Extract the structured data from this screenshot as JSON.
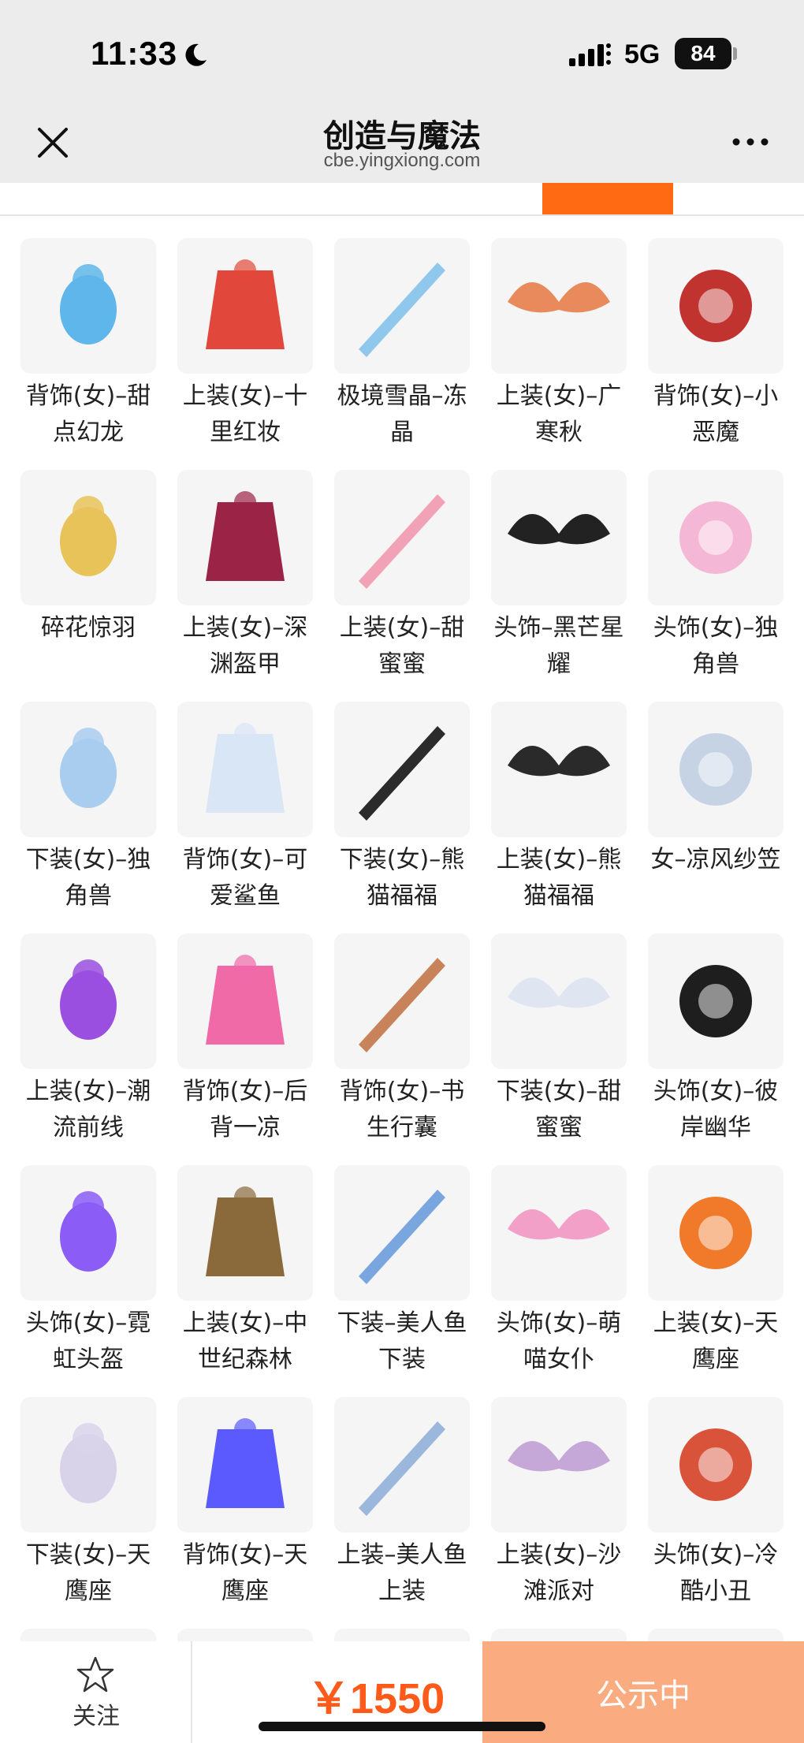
{
  "status_bar": {
    "time": "11:33",
    "network": "5G",
    "battery": "84"
  },
  "nav": {
    "title": "创造与魔法",
    "url": "cbe.yingxiong.com"
  },
  "items": [
    {
      "name": "背饰(女)–甜点幻龙",
      "icon": "dragon-icon",
      "color": "#5fb6ea"
    },
    {
      "name": "上装(女)–十里红妆",
      "icon": "dress-icon",
      "color": "#e2473b"
    },
    {
      "name": "极境雪晶–冻晶",
      "icon": "sword-icon",
      "color": "#8fc8ec"
    },
    {
      "name": "上装(女)–广寒秋",
      "icon": "robe-icon",
      "color": "#e98a5c"
    },
    {
      "name": "背饰(女)–小恶魔",
      "icon": "wings-icon",
      "color": "#c0332f"
    },
    {
      "name": "碎花惊羽",
      "icon": "feather-icon",
      "color": "#e8c35a"
    },
    {
      "name": "上装(女)–深渊盔甲",
      "icon": "armor-icon",
      "color": "#9b2346"
    },
    {
      "name": "上装(女)–甜蜜蜜",
      "icon": "gown-icon",
      "color": "#f2a2b6"
    },
    {
      "name": "头饰–黑芒星耀",
      "icon": "cap-icon",
      "color": "#222222"
    },
    {
      "name": "头饰(女)–独角兽",
      "icon": "unicorn-hood-icon",
      "color": "#f4b8d6"
    },
    {
      "name": "下装(女)–独角兽",
      "icon": "shorts-icon",
      "color": "#a9cdee"
    },
    {
      "name": "背饰(女)–可爱鲨鱼",
      "icon": "shark-icon",
      "color": "#d8e6f6"
    },
    {
      "name": "下装(女)–熊猫福福",
      "icon": "skirt-icon",
      "color": "#2b2b2b"
    },
    {
      "name": "上装(女)–熊猫福福",
      "icon": "jacket-icon",
      "color": "#2a2a2a"
    },
    {
      "name": "女–凉风纱笠",
      "icon": "veil-hat-icon",
      "color": "#c6d3e4"
    },
    {
      "name": "上装(女)–潮流前线",
      "icon": "hoodie-icon",
      "color": "#9a4fe0"
    },
    {
      "name": "背饰(女)–后背一凉",
      "icon": "icecream-icon",
      "color": "#f06aa8"
    },
    {
      "name": "背饰(女)–书生行囊",
      "icon": "backpack-icon",
      "color": "#c9835a"
    },
    {
      "name": "下装(女)–甜蜜蜜",
      "icon": "boots-icon",
      "color": "#dfe6f2"
    },
    {
      "name": "头饰(女)–彼岸幽华",
      "icon": "black-hair-icon",
      "color": "#1e1e1e"
    },
    {
      "name": "头饰(女)–霓虹头盔",
      "icon": "helmet-icon",
      "color": "#8b5cf6"
    },
    {
      "name": "上装(女)–中世纪森林",
      "icon": "medieval-dress-icon",
      "color": "#8a6a3a"
    },
    {
      "name": "下装–美人鱼下装",
      "icon": "fish-tail-icon",
      "color": "#7aa6e0"
    },
    {
      "name": "头饰(女)–萌喵女仆",
      "icon": "pink-hair-icon",
      "color": "#f3a0c8"
    },
    {
      "name": "上装(女)–天鹰座",
      "icon": "orange-jacket-icon",
      "color": "#f07a2a"
    },
    {
      "name": "下装(女)–天鹰座",
      "icon": "pants-icon",
      "color": "#d9d3ea"
    },
    {
      "name": "背饰(女)–天鹰座",
      "icon": "orb-pack-icon",
      "color": "#5a5aff"
    },
    {
      "name": "上装–美人鱼上装",
      "icon": "shell-top-icon",
      "color": "#9bb8dc"
    },
    {
      "name": "上装(女)–沙滩派对",
      "icon": "swim-top-icon",
      "color": "#c5a7d8"
    },
    {
      "name": "头饰(女)–冷酷小丑",
      "icon": "pigtails-icon",
      "color": "#d9533a"
    }
  ],
  "bottom_bar": {
    "follow_label": "关注",
    "price": "￥1550",
    "status_label": "公示中"
  }
}
